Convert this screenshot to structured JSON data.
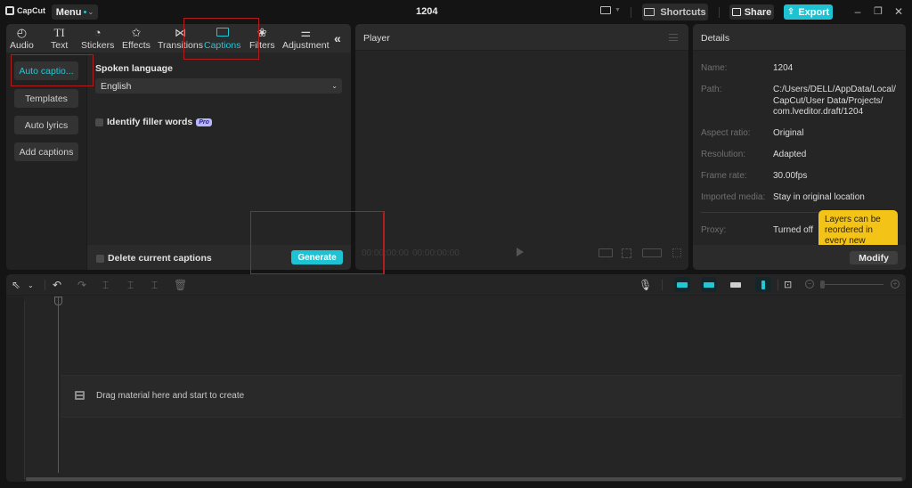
{
  "app": {
    "logo": "CapCut",
    "menu_label": "Menu",
    "project_title": "1204"
  },
  "titlebar": {
    "layout_icon": "layout-icon",
    "shortcuts_label": "Shortcuts",
    "share_label": "Share",
    "export_label": "Export",
    "accent_color": "#1ec3d3"
  },
  "tabs": [
    {
      "label": "Audio",
      "icon": "audio-icon"
    },
    {
      "label": "Text",
      "icon": "text-icon"
    },
    {
      "label": "Stickers",
      "icon": "stickers-icon"
    },
    {
      "label": "Effects",
      "icon": "effects-icon"
    },
    {
      "label": "Transitions",
      "icon": "transitions-icon"
    },
    {
      "label": "Captions",
      "icon": "captions-icon",
      "active": true
    },
    {
      "label": "Filters",
      "icon": "filters-icon"
    },
    {
      "label": "Adjustment",
      "icon": "adjustment-icon"
    }
  ],
  "captions": {
    "side_items": [
      {
        "label": "Auto captio...",
        "active": true
      },
      {
        "label": "Templates"
      },
      {
        "label": "Auto lyrics"
      },
      {
        "label": "Add captions"
      }
    ],
    "spoken_language_label": "Spoken language",
    "spoken_language_value": "English",
    "filler_words_label": "Identify filler words",
    "pro_badge": "Pro",
    "delete_captions_label": "Delete current captions",
    "generate_label": "Generate"
  },
  "player": {
    "title": "Player",
    "current_time": "00:00:00:00",
    "total_time": "00:00:00:00"
  },
  "details": {
    "title": "Details",
    "rows": [
      {
        "label": "Name:",
        "value": "1204"
      },
      {
        "label": "Path:",
        "value": "C:/Users/DELL/AppData/Local/\nCapCut/User Data/Projects/\ncom.lveditor.draft/1204"
      },
      {
        "label": "Aspect ratio:",
        "value": "Original"
      },
      {
        "label": "Resolution:",
        "value": "Adapted"
      },
      {
        "label": "Frame rate:",
        "value": "30.00fps"
      },
      {
        "label": "Imported media:",
        "value": "Stay in original location"
      },
      {
        "label": "Proxy:",
        "value": "Turned off"
      }
    ],
    "tooltip": "Layers can be reordered in every new",
    "modify_label": "Modify"
  },
  "timeline": {
    "drop_hint": "Drag material here and start to create"
  }
}
